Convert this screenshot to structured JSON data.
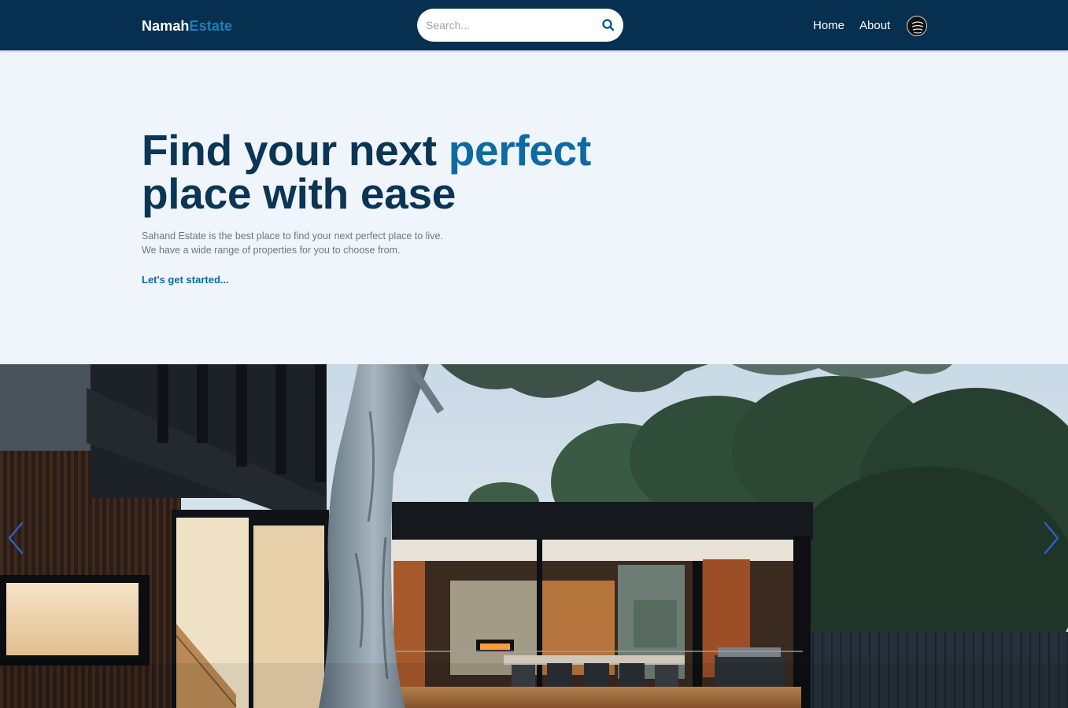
{
  "header": {
    "brand_part1": "Namah",
    "brand_part2": "Estate",
    "search_placeholder": "Search...",
    "nav": [
      {
        "label": "Home"
      },
      {
        "label": "About"
      }
    ]
  },
  "hero": {
    "title_part1": "Find your next ",
    "title_accent": "perfect",
    "title_part2": "place with ease",
    "description_line1": "Sahand Estate is the best place to find your next perfect place to live.",
    "description_line2": "We have a wide range of properties for you to choose from.",
    "cta": "Let's get started..."
  },
  "carousel": {
    "slide_subject": "modern house with glass walls, wooden deck and large tree at dusk"
  },
  "colors": {
    "header_bg": "#072f50",
    "page_bg": "#f0f4fb",
    "title_dark": "#0a3555",
    "accent": "#0d6aa3"
  }
}
